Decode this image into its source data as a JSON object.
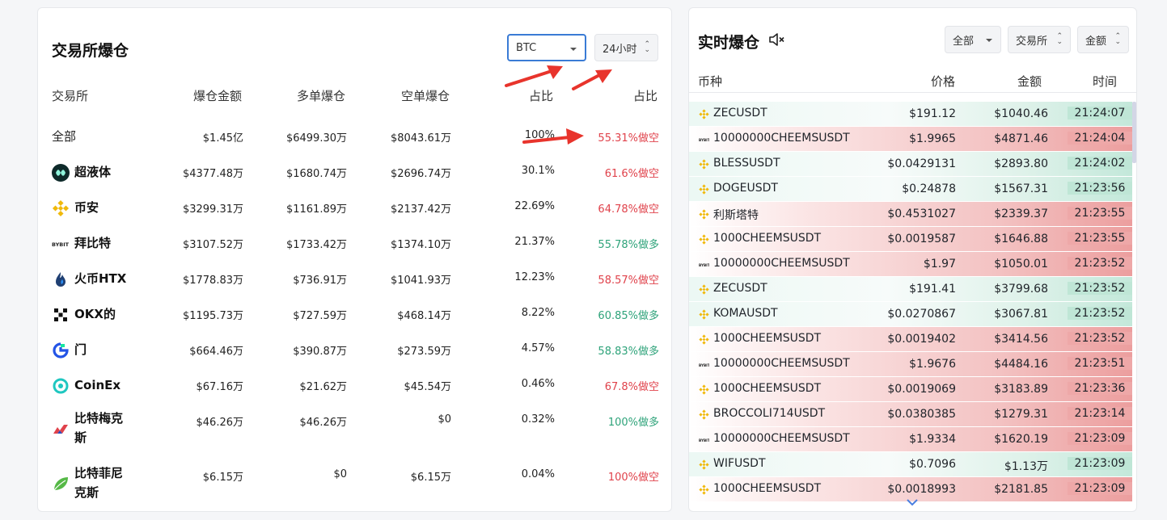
{
  "left_panel": {
    "title": "交易所爆仓",
    "coin_select": "BTC",
    "period_select": "24小时",
    "headers": [
      "交易所",
      "爆仓金额",
      "多单爆仓",
      "空单爆仓",
      "占比",
      "占比"
    ],
    "rows": [
      {
        "name": "全部",
        "icon": "",
        "total": "$1.45亿",
        "long": "$6499.30万",
        "short": "$8043.61万",
        "share": "100%",
        "ratio": "55.31%做空",
        "ratio_side": "short"
      },
      {
        "name": "超液体",
        "icon": "hyperliquid-logo-icon",
        "total": "$4377.48万",
        "long": "$1680.74万",
        "short": "$2696.74万",
        "share": "30.1%",
        "ratio": "61.6%做空",
        "ratio_side": "short"
      },
      {
        "name": "币安",
        "icon": "binance-logo-icon",
        "total": "$3299.31万",
        "long": "$1161.89万",
        "short": "$2137.42万",
        "share": "22.69%",
        "ratio": "64.78%做空",
        "ratio_side": "short"
      },
      {
        "name": "拜比特",
        "icon": "bybit-logo-icon",
        "total": "$3107.52万",
        "long": "$1733.42万",
        "short": "$1374.10万",
        "share": "21.37%",
        "ratio": "55.78%做多",
        "ratio_side": "long"
      },
      {
        "name": "火币HTX",
        "icon": "htx-logo-icon",
        "total": "$1778.83万",
        "long": "$736.91万",
        "short": "$1041.93万",
        "share": "12.23%",
        "ratio": "58.57%做空",
        "ratio_side": "short"
      },
      {
        "name": "OKX的",
        "icon": "okx-logo-icon",
        "total": "$1195.73万",
        "long": "$727.59万",
        "short": "$468.14万",
        "share": "8.22%",
        "ratio": "60.85%做多",
        "ratio_side": "long"
      },
      {
        "name": "门",
        "icon": "gate-logo-icon",
        "total": "$664.46万",
        "long": "$390.87万",
        "short": "$273.59万",
        "share": "4.57%",
        "ratio": "58.83%做多",
        "ratio_side": "long"
      },
      {
        "name": "CoinEx",
        "icon": "coinex-logo-icon",
        "total": "$67.16万",
        "long": "$21.62万",
        "short": "$45.54万",
        "share": "0.46%",
        "ratio": "67.8%做空",
        "ratio_side": "short"
      },
      {
        "name": "比特梅克斯",
        "name_line1": "比特梅克",
        "name_line2": "斯",
        "icon": "bitmex-logo-icon",
        "total": "$46.26万",
        "long": "$46.26万",
        "short": "$0",
        "share": "0.32%",
        "ratio": "100%做多",
        "ratio_side": "long"
      },
      {
        "name": "比特菲尼克斯",
        "name_line1": "比特菲尼",
        "name_line2": "克斯",
        "icon": "bitfinex-logo-icon",
        "total": "$6.15万",
        "long": "$0",
        "short": "$6.15万",
        "share": "0.04%",
        "ratio": "100%做空",
        "ratio_side": "short"
      }
    ]
  },
  "right_panel": {
    "title": "实时爆仓",
    "mute_icon": "speaker-muted-icon",
    "filters": {
      "all": "全部",
      "exchange": "交易所",
      "amount": "金额"
    },
    "headers": {
      "symbol": "币种",
      "price": "价格",
      "amount": "金额",
      "time": "时间"
    },
    "rows": [
      {
        "exchange_icon": "binance",
        "symbol": "ZECUSDT",
        "price": "$191.12",
        "amount": "$1040.46",
        "time": "21:24:07",
        "side": "long"
      },
      {
        "exchange_icon": "bybit",
        "symbol": "10000000CHEEMSUSDT",
        "price": "$1.9965",
        "amount": "$4871.46",
        "time": "21:24:04",
        "side": "short"
      },
      {
        "exchange_icon": "binance",
        "symbol": "BLESSUSDT",
        "price": "$0.0429131",
        "amount": "$2893.80",
        "time": "21:24:02",
        "side": "long"
      },
      {
        "exchange_icon": "binance",
        "symbol": "DOGEUSDT",
        "price": "$0.24878",
        "amount": "$1567.31",
        "time": "21:23:56",
        "side": "long"
      },
      {
        "exchange_icon": "binance",
        "symbol": "利斯塔特",
        "price": "$0.4531027",
        "amount": "$2339.37",
        "time": "21:23:55",
        "side": "short"
      },
      {
        "exchange_icon": "binance",
        "symbol": "1000CHEEMSUSDT",
        "price": "$0.0019587",
        "amount": "$1646.88",
        "time": "21:23:55",
        "side": "short"
      },
      {
        "exchange_icon": "bybit",
        "symbol": "10000000CHEEMSUSDT",
        "price": "$1.97",
        "amount": "$1050.01",
        "time": "21:23:52",
        "side": "short"
      },
      {
        "exchange_icon": "binance",
        "symbol": "ZECUSDT",
        "price": "$191.41",
        "amount": "$3799.68",
        "time": "21:23:52",
        "side": "long"
      },
      {
        "exchange_icon": "binance",
        "symbol": "KOMAUSDT",
        "price": "$0.0270867",
        "amount": "$3067.81",
        "time": "21:23:52",
        "side": "long"
      },
      {
        "exchange_icon": "binance",
        "symbol": "1000CHEEMSUSDT",
        "price": "$0.0019402",
        "amount": "$3414.56",
        "time": "21:23:52",
        "side": "short"
      },
      {
        "exchange_icon": "bybit",
        "symbol": "10000000CHEEMSUSDT",
        "price": "$1.9676",
        "amount": "$4484.16",
        "time": "21:23:51",
        "side": "short"
      },
      {
        "exchange_icon": "binance",
        "symbol": "1000CHEEMSUSDT",
        "price": "$0.0019069",
        "amount": "$3183.89",
        "time": "21:23:36",
        "side": "short"
      },
      {
        "exchange_icon": "binance",
        "symbol": "BROCCOLI714USDT",
        "price": "$0.0380385",
        "amount": "$1279.31",
        "time": "21:23:14",
        "side": "short"
      },
      {
        "exchange_icon": "bybit",
        "symbol": "10000000CHEEMSUSDT",
        "price": "$1.9334",
        "amount": "$1620.19",
        "time": "21:23:09",
        "side": "short"
      },
      {
        "exchange_icon": "binance",
        "symbol": "WIFUSDT",
        "price": "$0.7096",
        "amount": "$1.13万",
        "time": "21:23:09",
        "side": "long"
      },
      {
        "exchange_icon": "binance",
        "symbol": "1000CHEEMSUSDT",
        "price": "$0.0018993",
        "amount": "$2181.85",
        "time": "21:23:09",
        "side": "short"
      }
    ]
  },
  "colors": {
    "short": "#e0424b",
    "long": "#2ea37a",
    "arrow": "#e8342c",
    "accent": "#3a7bd5"
  }
}
